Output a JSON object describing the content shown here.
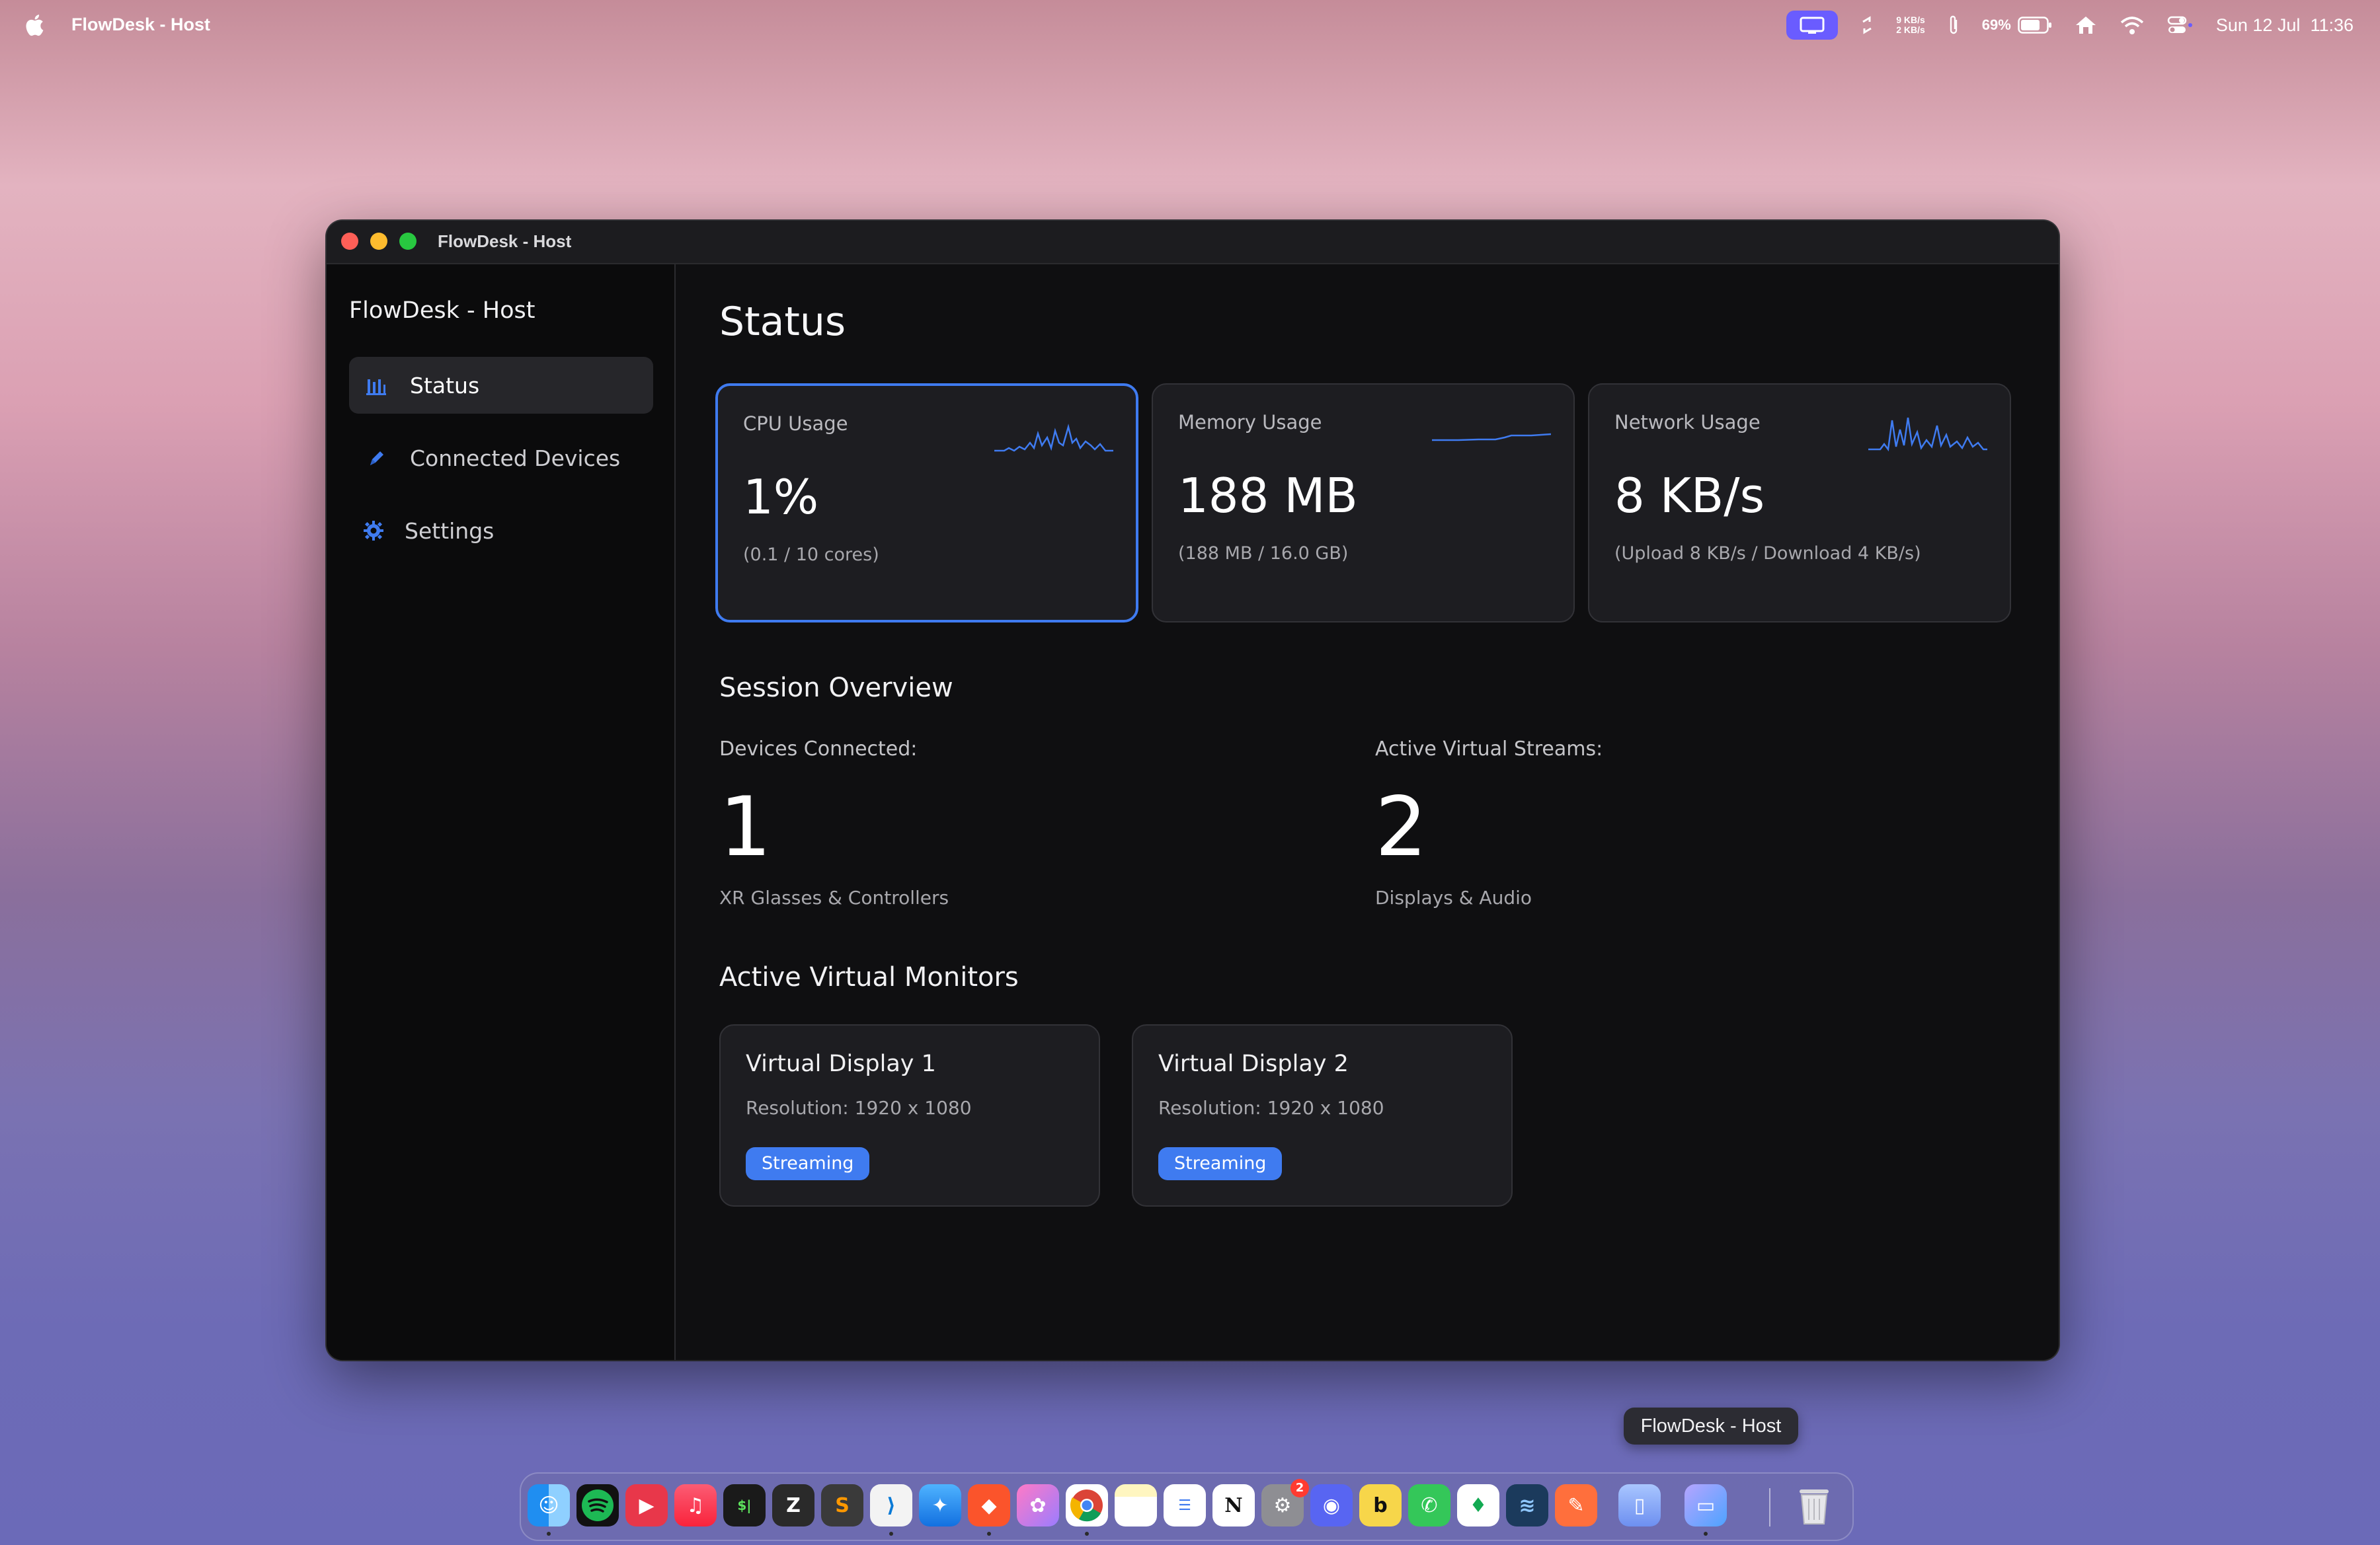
{
  "menubar": {
    "app_name": "FlowDesk - Host",
    "net_up": "9 KB/s",
    "net_down": "2 KB/s",
    "battery": "69%",
    "datetime": "Sun 12 Jul  11:36"
  },
  "window": {
    "title": "FlowDesk - Host"
  },
  "sidebar": {
    "title": "FlowDesk - Host",
    "items": [
      {
        "label": "Status",
        "icon": "bar-chart-icon",
        "active": true
      },
      {
        "label": "Connected Devices",
        "icon": "pen-icon",
        "active": false
      },
      {
        "label": "Settings",
        "icon": "gear-icon",
        "active": false
      }
    ]
  },
  "main": {
    "title": "Status",
    "cards": [
      {
        "label": "CPU Usage",
        "value": "1%",
        "sub": "(0.1 / 10 cores)"
      },
      {
        "label": "Memory Usage",
        "value": "188 MB",
        "sub": "(188 MB / 16.0 GB)"
      },
      {
        "label": "Network Usage",
        "value": "8 KB/s",
        "sub": "(Upload 8 KB/s / Download 4 KB/s)"
      }
    ],
    "session": {
      "title": "Session Overview",
      "devices_label": "Devices Connected:",
      "devices_value": "1",
      "devices_sub": "XR Glasses & Controllers",
      "streams_label": "Active Virtual Streams:",
      "streams_value": "2",
      "streams_sub": "Displays & Audio"
    },
    "monitors": {
      "title": "Active Virtual Monitors",
      "items": [
        {
          "name": "Virtual Display 1",
          "resolution": "Resolution: 1920 x 1080",
          "status": "Streaming"
        },
        {
          "name": "Virtual Display 2",
          "resolution": "Resolution: 1920 x 1080",
          "status": "Streaming"
        }
      ]
    }
  },
  "dock": {
    "tooltip": "FlowDesk - Host",
    "settings_badge": "2"
  },
  "colors": {
    "accent": "#3f7bf0",
    "window_bg": "#0f0f11",
    "card_bg": "#1d1d21"
  }
}
